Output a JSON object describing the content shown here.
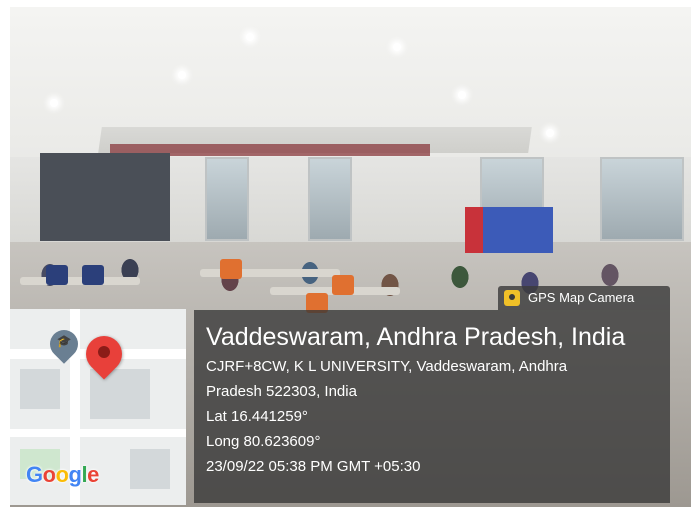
{
  "overlay": {
    "badge_label": "GPS Map Camera",
    "badge_icon": "gps-map-camera-icon",
    "title": "Vaddeswaram, Andhra Pradesh, India",
    "address_line1": "CJRF+8CW, K L UNIVERSITY, Vaddeswaram, Andhra",
    "address_line2": "Pradesh 522303, India",
    "latitude": "Lat 16.441259°",
    "longitude": "Long 80.623609°",
    "timestamp": "23/09/22 05:38 PM GMT +05:30"
  },
  "map": {
    "logo_text": "Google",
    "pin_icon": "location-pin-icon",
    "place_icon": "graduation-cap-icon",
    "pin_color": "#e8403a"
  }
}
